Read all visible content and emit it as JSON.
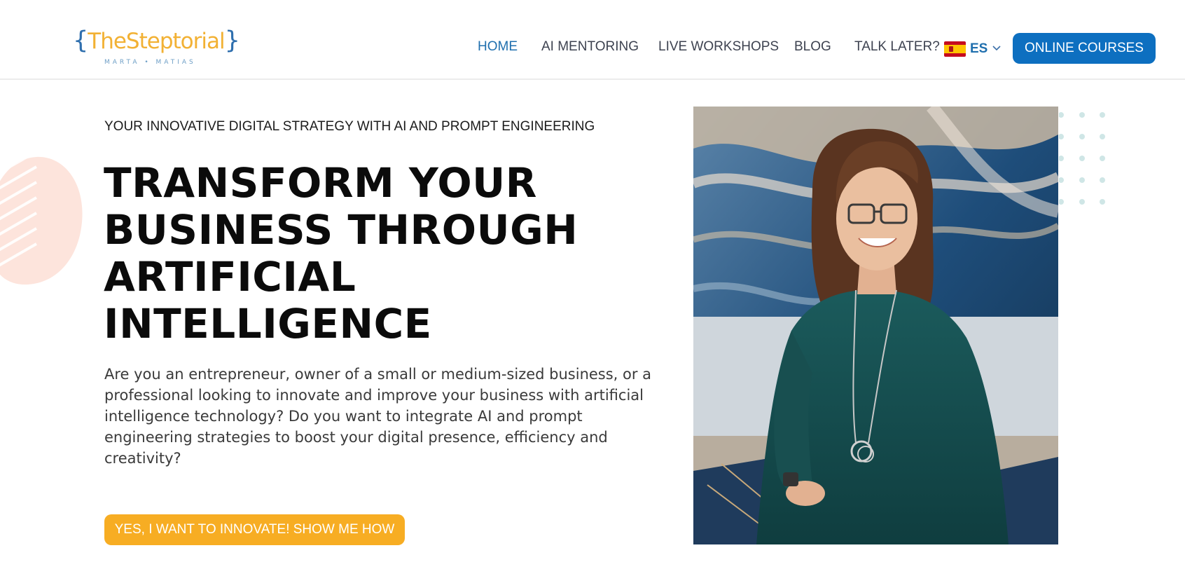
{
  "brand": {
    "logo_open_brace": "{",
    "logo_name": "TheSteptorial",
    "logo_close_brace": "}",
    "logo_subtitle": "MARTA • MATIAS"
  },
  "nav": {
    "items": [
      {
        "label": "HOME",
        "active": true
      },
      {
        "label": "AI MENTORING",
        "active": false
      },
      {
        "label": "LIVE WORKSHOPS",
        "active": false
      },
      {
        "label": "BLOG",
        "active": false
      },
      {
        "label": "TALK LATER?",
        "active": false
      }
    ],
    "language": {
      "flag_icon": "spain-flag-icon",
      "code": "ES",
      "dropdown_icon": "chevron-down-icon"
    },
    "cta_label": "ONLINE COURSES"
  },
  "hero": {
    "eyebrow": "YOUR INNOVATIVE DIGITAL STRATEGY WITH AI AND PROMPT ENGINEERING",
    "headline_lines": [
      "TRANSFORM YOUR",
      "BUSINESS THROUGH",
      "ARTIFICIAL",
      "INTELLIGENCE"
    ],
    "intro": "Are you an entrepreneur, owner of a small or medium-sized business, or a professional looking to innovate and improve your business with artificial intelligence technology? Do you want to integrate AI and prompt engineering strategies to boost your digital presence, efficiency and creativity?",
    "cta_label": "YES, I WANT TO INNOVATE! SHOW ME HOW"
  },
  "colors": {
    "brand_blue": "#0d6fc0",
    "accent_orange": "#f7ad23",
    "logo_gold": "#f2b134",
    "logo_blue": "#2f6fae",
    "deco_pink": "#fde4dc",
    "deco_dots": "#cfe6e6"
  }
}
